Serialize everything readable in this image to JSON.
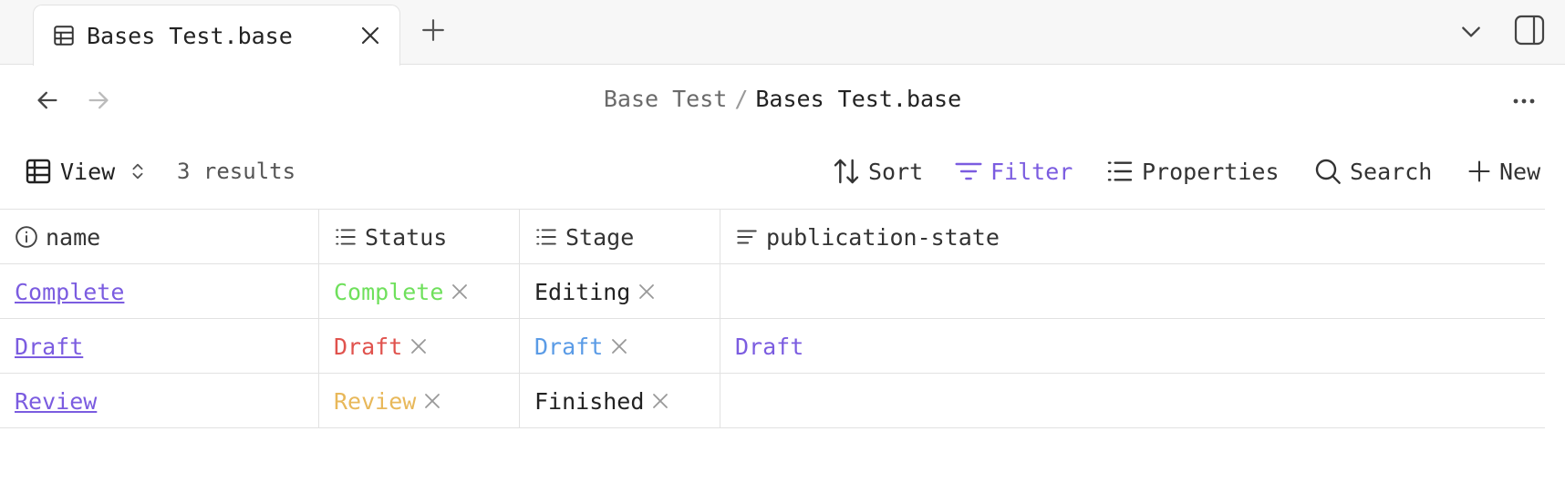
{
  "tabs": [
    {
      "title": "Bases Test.base",
      "icon": "table-icon"
    }
  ],
  "breadcrumb": {
    "parent": "Base Test",
    "separator": "/",
    "current": "Bases Test.base"
  },
  "toolbar": {
    "view_label": "View",
    "results": "3 results",
    "sort_label": "Sort",
    "filter_label": "Filter",
    "properties_label": "Properties",
    "search_label": "Search",
    "new_label": "New"
  },
  "table": {
    "columns": [
      {
        "label": "name",
        "icon": "info-icon"
      },
      {
        "label": "Status",
        "icon": "list-icon"
      },
      {
        "label": "Stage",
        "icon": "list-icon"
      },
      {
        "label": "publication-state",
        "icon": "text-lines-icon"
      }
    ],
    "rows": [
      {
        "name": "Complete",
        "status": "Complete",
        "status_color": "#6fe05c",
        "stage": "Editing",
        "stage_color": "#222222",
        "publication_state": "",
        "publication_color": "#7b5ce0"
      },
      {
        "name": "Draft",
        "status": "Draft",
        "status_color": "#e0524d",
        "stage": "Draft",
        "stage_color": "#5a9be6",
        "publication_state": "Draft",
        "publication_color": "#7b5ce0"
      },
      {
        "name": "Review",
        "status": "Review",
        "status_color": "#e8b85a",
        "stage": "Finished",
        "stage_color": "#222222",
        "publication_state": "",
        "publication_color": "#7b5ce0"
      }
    ]
  },
  "colors": {
    "accent": "#7b5ce0",
    "border": "#e2e2e2",
    "tabbar_bg": "#f7f7f7"
  }
}
